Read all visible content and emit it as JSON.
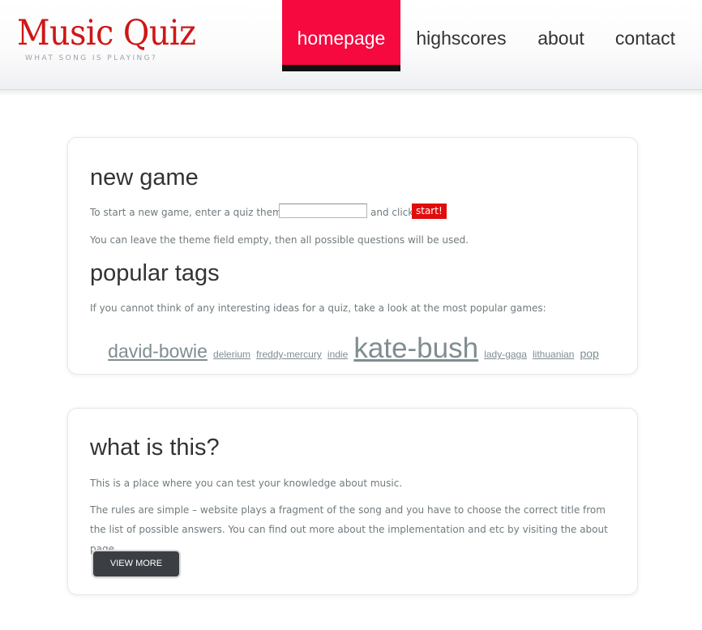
{
  "brand": {
    "title": "Music Quiz",
    "subtitle": "WHAT SONG IS PLAYING?",
    "title_color": "#cf1616"
  },
  "nav": {
    "items": [
      {
        "label": "homepage",
        "active": true
      },
      {
        "label": "highscores",
        "active": false
      },
      {
        "label": "about",
        "active": false
      },
      {
        "label": "contact",
        "active": false
      }
    ],
    "active_color": "#f5093f"
  },
  "new_game": {
    "heading": "new game",
    "intro_before": "To start a new game, enter a quiz theme",
    "theme_value": "",
    "intro_after": "and click",
    "start_label": "start!",
    "note": "You can leave the theme field empty, then all possible questions will be used."
  },
  "popular_tags": {
    "heading": "popular tags",
    "intro": "If you cannot think of any interesting ideas for a quiz, take a look at the most popular games:",
    "tags": [
      {
        "label": "david-bowie"
      },
      {
        "label": "delerium"
      },
      {
        "label": "freddy-mercury"
      },
      {
        "label": "indie"
      },
      {
        "label": "kate-bush"
      },
      {
        "label": "lady-gaga"
      },
      {
        "label": "lithuanian"
      },
      {
        "label": "pop"
      }
    ]
  },
  "about": {
    "heading": "what is this?",
    "para1": "This is a place where you can test your knowledge about music.",
    "para2": "The rules are simple – website plays a fragment of the song and you have to choose the correct title from the list of possible answers. You can find out more about the implementation and etc by visiting the about page.",
    "button_label": "VIEW MORE"
  }
}
